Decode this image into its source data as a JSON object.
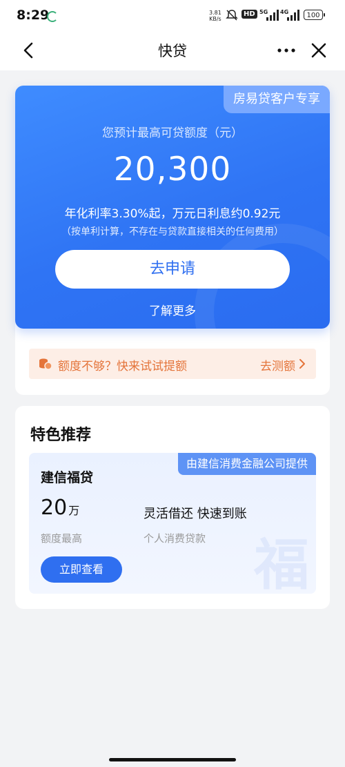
{
  "status_bar": {
    "time": "8:29",
    "net_speed_value": "3.81",
    "net_speed_unit": "KB/s",
    "hd": "HD",
    "net1": "5G",
    "net2": "4G",
    "battery": "100"
  },
  "nav": {
    "title": "快贷"
  },
  "loan_card": {
    "badge": "房易贷客户专享",
    "quota_label": "您预计最高可贷额度（元）",
    "quota_amount": "20,300",
    "rate_line": "年化利率3.30%起，万元日利息约0.92元",
    "note_line": "（按单利计算，不存在与贷款直接相关的任何费用）",
    "apply_label": "去申请",
    "learn_more": "了解更多"
  },
  "tip": {
    "text": "额度不够？快来试试提额",
    "action": "去测额"
  },
  "featured": {
    "title": "特色推荐",
    "product": {
      "provider": "由建信消费金融公司提供",
      "name": "建信福贷",
      "amount": "20",
      "amount_unit": "万",
      "amount_caption": "额度最高",
      "feature": "灵活借还 快速到账",
      "type_caption": "个人消费贷款",
      "button": "立即查看"
    }
  },
  "colors": {
    "primary_blue": "#2f6ff0",
    "tip_orange": "#e4743a",
    "tip_bg": "#fdeee6"
  }
}
